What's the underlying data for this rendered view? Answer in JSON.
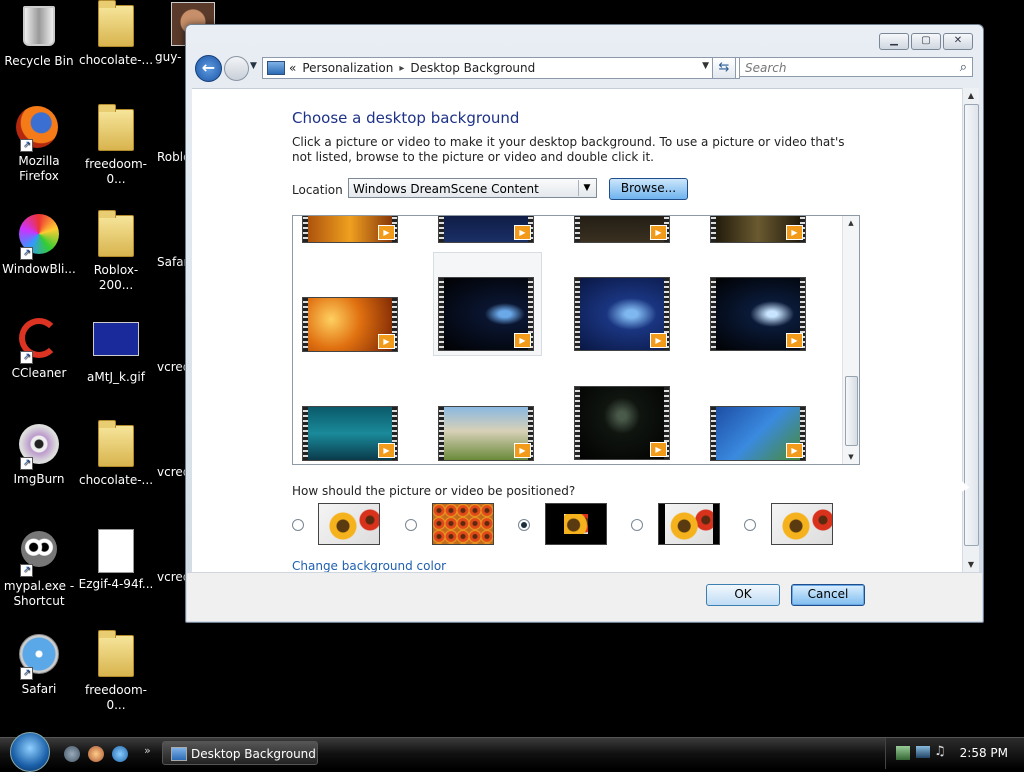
{
  "desktop": {
    "icons": [
      {
        "label": "Recycle Bin"
      },
      {
        "label": "Mozilla Firefox"
      },
      {
        "label": "WindowBli..."
      },
      {
        "label": "CCleaner"
      },
      {
        "label": "ImgBurn"
      },
      {
        "label": "mypal.exe - Shortcut"
      },
      {
        "label": "Safari"
      },
      {
        "label": "chocolate-..."
      },
      {
        "label": "freedoom-0..."
      },
      {
        "label": "Roblox-200..."
      },
      {
        "label": "aMtJ_k.gif"
      },
      {
        "label": "chocolate-..."
      },
      {
        "label": "Ezgif-4-94f..."
      },
      {
        "label": "freedoom-0..."
      },
      {
        "label": "guy-"
      },
      {
        "label": "Roblo"
      },
      {
        "label": "Safar"
      },
      {
        "label": "vcred"
      },
      {
        "label": "vcred"
      },
      {
        "label": "vcred"
      }
    ]
  },
  "window": {
    "breadcrumb": {
      "prefix": "«",
      "item1": "Personalization",
      "separator": "▸",
      "item2": "Desktop Background"
    },
    "search_placeholder": "Search",
    "heading": "Choose a desktop background",
    "description": "Click a picture or video to make it your desktop background. To use a picture or video that's not listed, browse to the picture or video and double click it.",
    "location_label": "Location",
    "location_value": "Windows DreamScene Content",
    "browse_label": "Browse...",
    "position_question": "How should the picture or video be positioned?",
    "position_selected_index": 2,
    "change_color_link": "Change background color",
    "ok_label": "OK",
    "cancel_label": "Cancel",
    "thumbnails": [
      {
        "name": "fire-partial"
      },
      {
        "name": "planet-partial"
      },
      {
        "name": "dark-scene-partial"
      },
      {
        "name": "tunnel-partial"
      },
      {
        "name": "fire"
      },
      {
        "name": "windows-ribbon"
      },
      {
        "name": "windows-ribbon-blue"
      },
      {
        "name": "windows-ribbon-dark"
      },
      {
        "name": "water"
      },
      {
        "name": "waterfall"
      },
      {
        "name": "windows-vista-logo"
      },
      {
        "name": "underwater-reef"
      }
    ]
  },
  "taskbar": {
    "active_window": "Desktop Background",
    "clock": "2:58 PM"
  }
}
